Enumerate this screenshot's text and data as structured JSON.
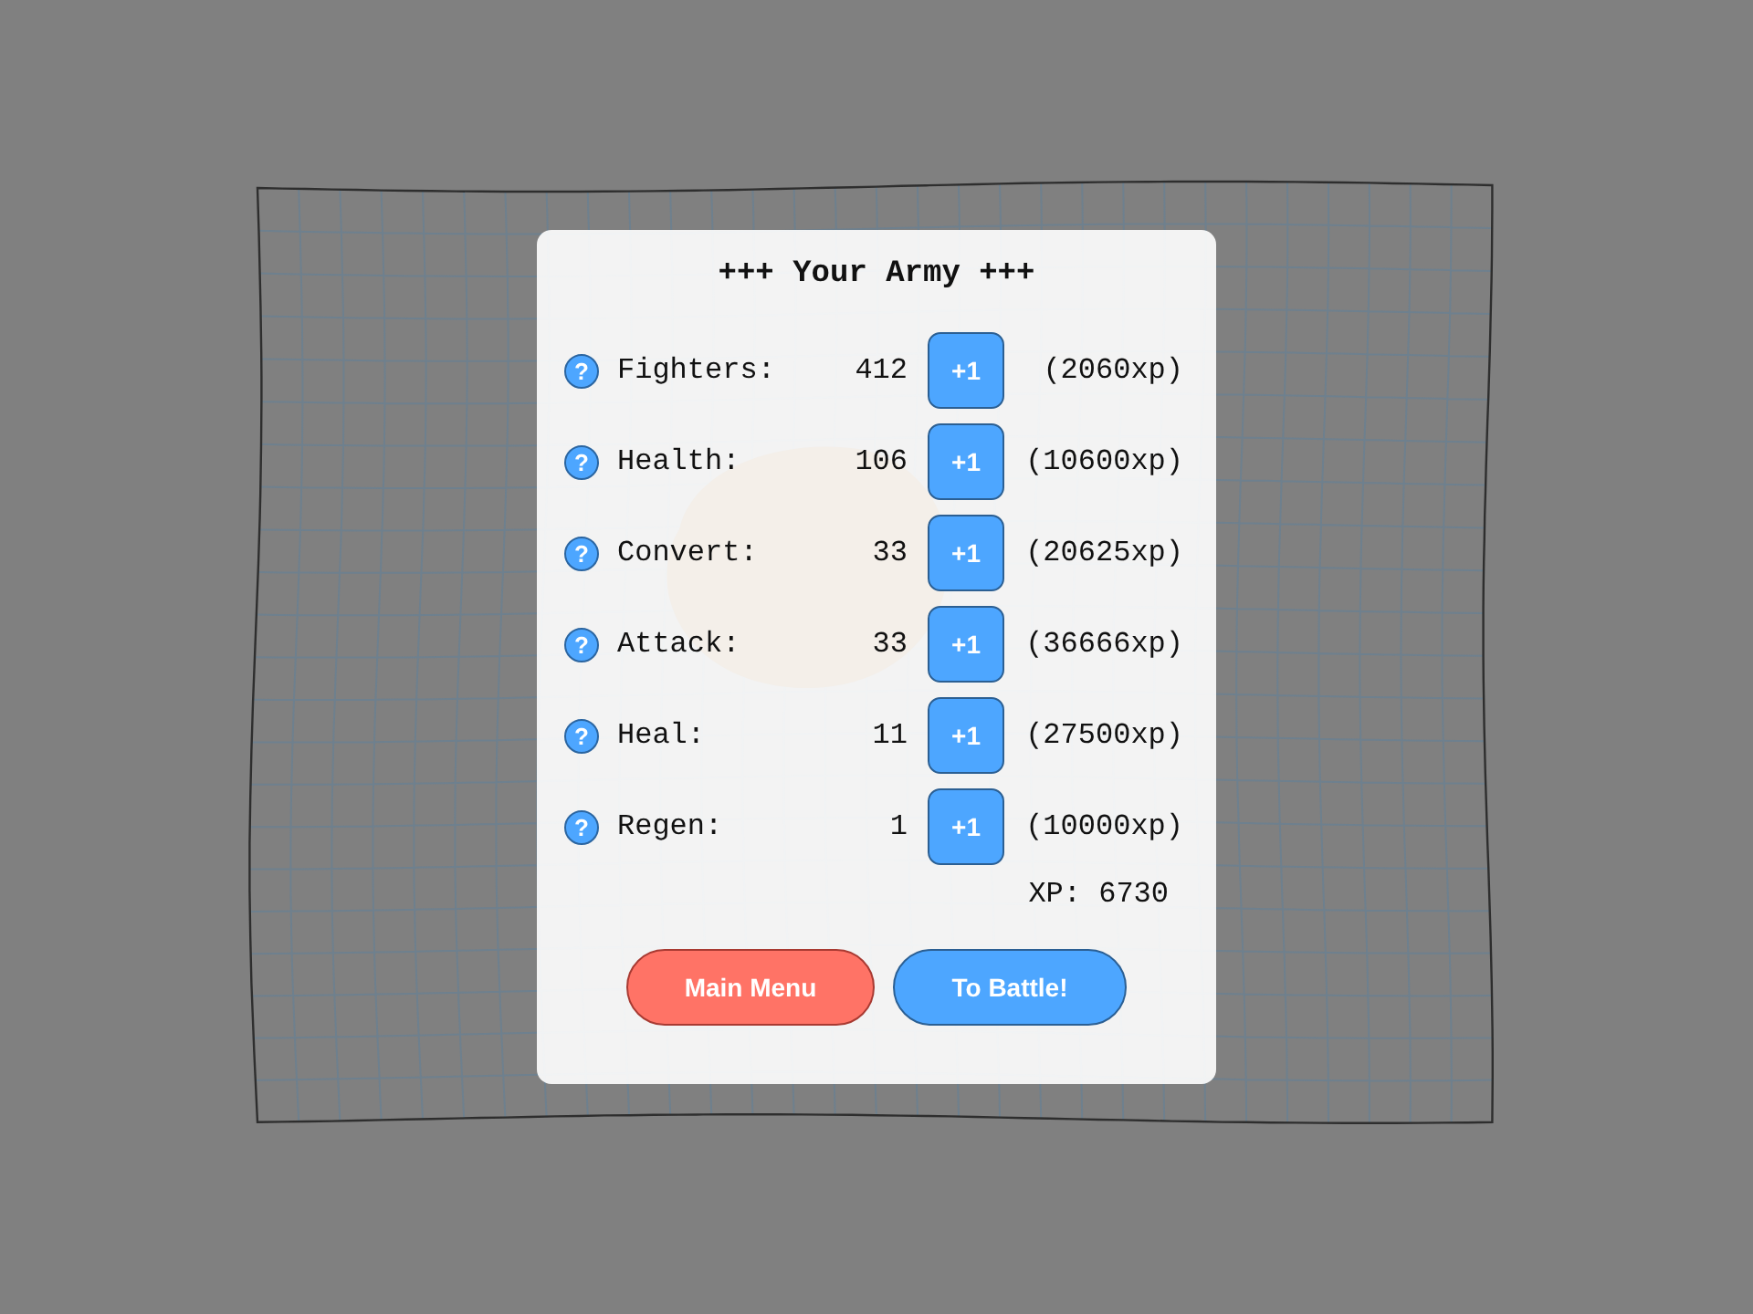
{
  "title": "+++ Your Army +++",
  "stats": [
    {
      "help": "?",
      "label": "Fighters:",
      "value": "412",
      "button": "+1",
      "cost": "(2060xp)"
    },
    {
      "help": "?",
      "label": "Health:",
      "value": "106",
      "button": "+1",
      "cost": "(10600xp)"
    },
    {
      "help": "?",
      "label": "Convert:",
      "value": "33",
      "button": "+1",
      "cost": "(20625xp)"
    },
    {
      "help": "?",
      "label": "Attack:",
      "value": "33",
      "button": "+1",
      "cost": "(36666xp)"
    },
    {
      "help": "?",
      "label": "Heal:",
      "value": "11",
      "button": "+1",
      "cost": "(27500xp)"
    },
    {
      "help": "?",
      "label": "Regen:",
      "value": "1",
      "button": "+1",
      "cost": "(10000xp)"
    }
  ],
  "xp": "XP: 6730",
  "buttons": [
    {
      "label": "Main Menu",
      "kind": "menu"
    },
    {
      "label": "To Battle!",
      "kind": "battle"
    }
  ]
}
